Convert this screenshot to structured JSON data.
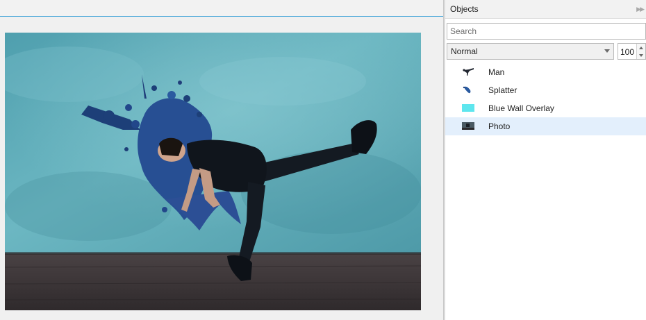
{
  "objects_panel": {
    "title": "Objects",
    "search_placeholder": "Search",
    "blend_mode": "Normal",
    "opacity": "100",
    "layers": [
      {
        "label": "Man",
        "icon": "man-thumbnail-icon",
        "selected": false
      },
      {
        "label": "Splatter",
        "icon": "splatter-thumbnail-icon",
        "selected": false
      },
      {
        "label": "Blue Wall Overlay",
        "icon": "blue-overlay-thumbnail-icon",
        "selected": false
      },
      {
        "label": "Photo",
        "icon": "photo-thumbnail-icon",
        "selected": true
      }
    ]
  },
  "colors": {
    "accent_line": "#3aa0d8",
    "selected_row": "#e3effc",
    "wall": "#5fa9b6",
    "floor": "#3e3a3c",
    "overlay_swatch": "#5ee6ee"
  }
}
